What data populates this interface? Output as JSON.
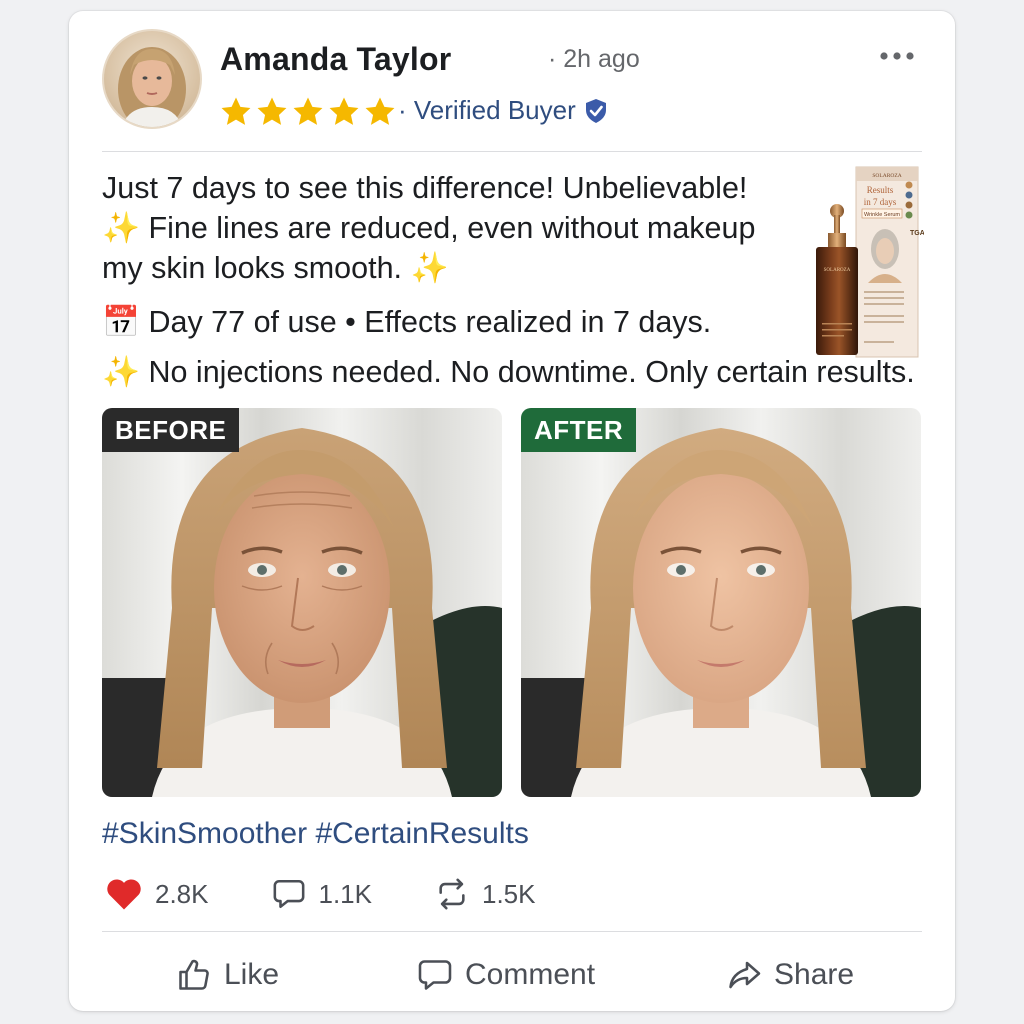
{
  "post": {
    "author": "Amanda Taylor",
    "time": "· 2h ago",
    "rating": 5,
    "verified_label": "· Verified Buyer",
    "text_line1": "Just 7 days to see this difference! Unbelievable!",
    "text_line2": "Fine lines are reduced, even without makeup",
    "text_line3": "my skin looks smooth.",
    "day_line": "Day 77 of use • Effects realized in 7 days.",
    "promise_line": "No injections needed. No downtime. Only certain results.",
    "sparkle_glyph": "✨",
    "calendar_glyph": "📅"
  },
  "product": {
    "brand": "SOLAROZA",
    "headline": "Results in 7 days",
    "subtitle": "Wrinkle Serum"
  },
  "photos": {
    "before_label": "BEFORE",
    "after_label": "AFTER",
    "before_color": "#2a2a2a",
    "after_color": "#1f6b3a"
  },
  "hashtags": "#SkinSmoother #CertainResults",
  "stats": {
    "likes": "2.8K",
    "comments": "1.1K",
    "shares": "1.5K"
  },
  "actions": {
    "like": "Like",
    "comment": "Comment",
    "share": "Share"
  },
  "colors": {
    "star": "#f5b800",
    "link_blue": "#2f4d7f",
    "heart": "#e02a2a"
  }
}
